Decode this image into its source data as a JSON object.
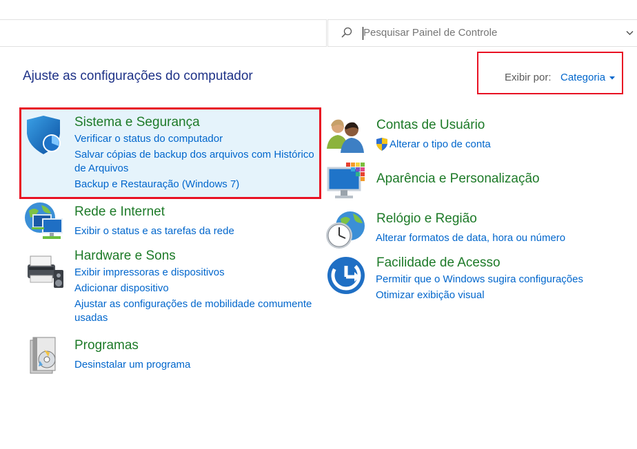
{
  "search": {
    "placeholder": "Pesquisar Painel de Controle"
  },
  "page_title": "Ajuste as configurações do computador",
  "view": {
    "label": "Exibir por:",
    "value": "Categoria"
  },
  "left_categories": [
    {
      "title": "Sistema e Segurança",
      "links": [
        "Verificar o status do computador",
        "Salvar cópias de backup dos arquivos com Histórico",
        "de Arquivos",
        "Backup e Restauração (Windows 7)"
      ]
    },
    {
      "title": "Rede e Internet",
      "links": [
        "Exibir o status e as tarefas da rede"
      ]
    },
    {
      "title": "Hardware e Sons",
      "links": [
        "Exibir impressoras e dispositivos",
        "Adicionar dispositivo",
        "Ajustar as configurações de mobilidade comumente",
        "usadas"
      ]
    },
    {
      "title": "Programas",
      "links": [
        "Desinstalar um programa"
      ]
    }
  ],
  "right_categories": [
    {
      "title": "Contas de Usuário",
      "links": [
        "Alterar o tipo de conta"
      ]
    },
    {
      "title": "Aparência e Personalização",
      "links": []
    },
    {
      "title": "Relógio e Região",
      "links": [
        "Alterar formatos de data, hora ou número"
      ]
    },
    {
      "title": "Facilidade de Acesso",
      "links": [
        "Permitir que o Windows sugira configurações",
        "Otimizar exibição visual"
      ]
    }
  ],
  "colors": {
    "title_blue": "#1e3287",
    "category_green": "#1d7a28",
    "link_blue": "#0066cc",
    "highlight_red": "#e81123",
    "highlight_bg": "#e5f3fb"
  },
  "icons": [
    "search-icon",
    "chevron-down-icon",
    "shield-icon",
    "network-globe-icon",
    "printer-icon",
    "programs-disc-icon",
    "users-icon",
    "uac-shield-icon",
    "display-palette-icon",
    "clock-globe-icon",
    "ease-of-access-icon"
  ]
}
